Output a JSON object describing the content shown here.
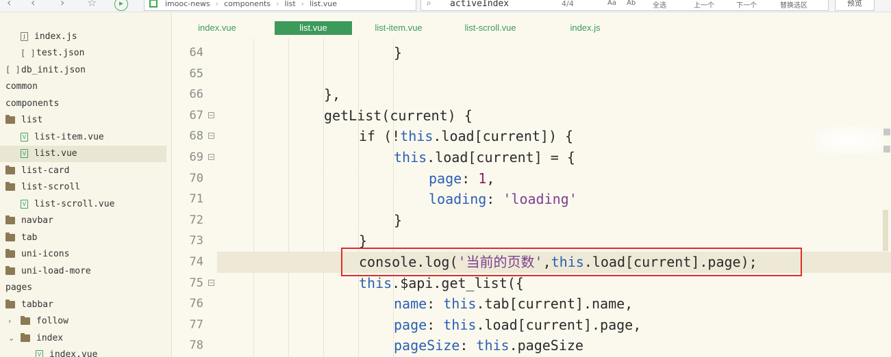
{
  "toolbar": {
    "back_icon": "chevron-left-icon",
    "forward_icon": "chevron-right-icon",
    "star_icon": "star-icon",
    "run_icon": "run-icon",
    "breadcrumb": [
      "imooc-news",
      "components",
      "list",
      "list.vue"
    ],
    "find_query": "activeIndex",
    "find_count": "4/4",
    "find_options": [
      "Aa",
      "Ab",
      "全选",
      "上一个",
      "下一个",
      "替换选区"
    ],
    "preview_label": "预览"
  },
  "sidebar": {
    "items": [
      {
        "label": "index.js",
        "icon": "js-file-icon",
        "indent": 30
      },
      {
        "label": "test.json",
        "icon": "json-file-icon",
        "indent": 30
      },
      {
        "label": "db_init.json",
        "icon": "json-file-icon",
        "indent": 8
      },
      {
        "label": "common",
        "icon": "",
        "indent": 8
      },
      {
        "label": "components",
        "icon": "",
        "indent": 8
      },
      {
        "label": "list",
        "icon": "folder-icon",
        "indent": 8
      },
      {
        "label": "list-item.vue",
        "icon": "vue-file-icon",
        "indent": 30
      },
      {
        "label": "list.vue",
        "icon": "vue-file-icon",
        "indent": 30,
        "selected": true
      },
      {
        "label": "list-card",
        "icon": "folder-icon",
        "indent": 8
      },
      {
        "label": "list-scroll",
        "icon": "folder-icon",
        "indent": 8
      },
      {
        "label": "list-scroll.vue",
        "icon": "vue-file-icon",
        "indent": 30
      },
      {
        "label": "navbar",
        "icon": "folder-icon",
        "indent": 8
      },
      {
        "label": "tab",
        "icon": "folder-icon",
        "indent": 8
      },
      {
        "label": "uni-icons",
        "icon": "folder-icon",
        "indent": 8
      },
      {
        "label": "uni-load-more",
        "icon": "folder-icon",
        "indent": 8
      },
      {
        "label": "pages",
        "icon": "",
        "indent": 8
      },
      {
        "label": "tabbar",
        "icon": "folder-icon",
        "indent": 8
      },
      {
        "label": "follow",
        "icon": "folder-icon",
        "indent": 12,
        "chevron": "›"
      },
      {
        "label": "index",
        "icon": "folder-icon",
        "indent": 12,
        "chevron": "⌄"
      },
      {
        "label": "index.vue",
        "icon": "vue-file-icon",
        "indent": 52
      }
    ]
  },
  "tabs": [
    {
      "label": "index.vue",
      "active": false
    },
    {
      "label": "list.vue",
      "active": true
    },
    {
      "label": "list-item.vue",
      "active": false
    },
    {
      "label": "list-scroll.vue",
      "active": false
    },
    {
      "label": "index.js",
      "active": false
    }
  ],
  "editor": {
    "lines": [
      {
        "num": "64",
        "fold": false,
        "indent": 4,
        "tokens": [
          [
            "p",
            "}"
          ]
        ]
      },
      {
        "num": "65",
        "fold": false,
        "indent": 0,
        "tokens": []
      },
      {
        "num": "66",
        "fold": false,
        "indent": 2,
        "tokens": [
          [
            "p",
            "},"
          ]
        ]
      },
      {
        "num": "67",
        "fold": true,
        "indent": 2,
        "tokens": [
          [
            "p",
            "getList(current) {"
          ]
        ]
      },
      {
        "num": "68",
        "fold": true,
        "indent": 3,
        "tokens": [
          [
            "p",
            "if (!"
          ],
          [
            "k",
            "this"
          ],
          [
            "p",
            ".load[current]) {"
          ]
        ]
      },
      {
        "num": "69",
        "fold": true,
        "indent": 4,
        "tokens": [
          [
            "k",
            "this"
          ],
          [
            "p",
            ".load[current] = {"
          ]
        ]
      },
      {
        "num": "70",
        "fold": false,
        "indent": 5,
        "tokens": [
          [
            "r",
            "page"
          ],
          [
            "p",
            ": "
          ],
          [
            "n",
            "1"
          ],
          [
            "p",
            ","
          ]
        ]
      },
      {
        "num": "71",
        "fold": false,
        "indent": 5,
        "tokens": [
          [
            "r",
            "loading"
          ],
          [
            "p",
            ": "
          ],
          [
            "s",
            "'loading'"
          ]
        ]
      },
      {
        "num": "72",
        "fold": false,
        "indent": 4,
        "tokens": [
          [
            "p",
            "}"
          ]
        ]
      },
      {
        "num": "73",
        "fold": false,
        "indent": 3,
        "tokens": [
          [
            "p",
            "}"
          ]
        ]
      },
      {
        "num": "74",
        "fold": false,
        "indent": 3,
        "highlight": true,
        "tokens": [
          [
            "p",
            "console.log("
          ],
          [
            "s",
            "'当前的页数'"
          ],
          [
            "p",
            ","
          ],
          [
            "k",
            "this"
          ],
          [
            "p",
            ".load[current].page);"
          ]
        ]
      },
      {
        "num": "75",
        "fold": true,
        "indent": 3,
        "tokens": [
          [
            "k",
            "this"
          ],
          [
            "p",
            ".$api.get_list({"
          ]
        ]
      },
      {
        "num": "76",
        "fold": false,
        "indent": 4,
        "tokens": [
          [
            "r",
            "name"
          ],
          [
            "p",
            ": "
          ],
          [
            "k",
            "this"
          ],
          [
            "p",
            ".tab[current].name,"
          ]
        ]
      },
      {
        "num": "77",
        "fold": false,
        "indent": 4,
        "tokens": [
          [
            "r",
            "page"
          ],
          [
            "p",
            ": "
          ],
          [
            "k",
            "this"
          ],
          [
            "p",
            ".load[current].page,"
          ]
        ]
      },
      {
        "num": "78",
        "fold": false,
        "indent": 4,
        "tokens": [
          [
            "r",
            "pageSize"
          ],
          [
            "p",
            ": "
          ],
          [
            "k",
            "this"
          ],
          [
            "p",
            ".pageSize"
          ]
        ]
      }
    ]
  },
  "colors": {
    "accent": "#3c9a5a",
    "keyword": "#2b5fb3",
    "string": "#7a3f8e",
    "number": "#8b1f6d",
    "annotation": "#e02a2a"
  }
}
